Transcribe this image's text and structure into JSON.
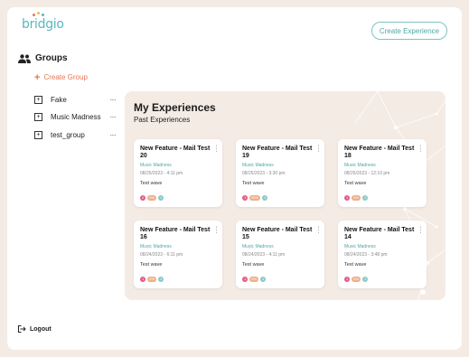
{
  "brand": {
    "logo_text": "bridgio"
  },
  "header": {
    "create_experience_label": "Create Experience"
  },
  "sidebar": {
    "groups_title": "Groups",
    "create_group_label": "Create Group",
    "groups": [
      {
        "label": "Fake",
        "menu": "···"
      },
      {
        "label": "Music Madness",
        "menu": "···"
      },
      {
        "label": "test_group",
        "menu": "···"
      }
    ],
    "logout_label": "Logout"
  },
  "experiences": {
    "title": "My Experiences",
    "subtitle": "Past Experiences",
    "cards": [
      {
        "title": "New Feature - Mail Test 20",
        "group": "Music Madness",
        "date": "08/25/2023 - 4:11 pm",
        "description": "Test wave",
        "badges": [
          "2",
          "0%",
          "1"
        ]
      },
      {
        "title": "New Feature - Mail Test 19",
        "group": "Music Madness",
        "date": "08/25/2023 - 3:30 pm",
        "description": "Test wave",
        "badges": [
          "1",
          "50%",
          "1"
        ]
      },
      {
        "title": "New Feature - Mail Test 18",
        "group": "Music Madness",
        "date": "08/25/2023 - 12:10 pm",
        "description": "Test wave",
        "badges": [
          "1",
          "0%",
          "1"
        ]
      },
      {
        "title": "New Feature - Mail Test 16",
        "group": "Music Madness",
        "date": "08/24/2023 - 6:11 pm",
        "description": "Test wave",
        "badges": [
          "1",
          "0%",
          "1"
        ]
      },
      {
        "title": "New Feature - Mail Test 15",
        "group": "Music Madness",
        "date": "08/24/2023 - 4:11 pm",
        "description": "Test wave",
        "badges": [
          "1",
          "0%",
          "1"
        ]
      },
      {
        "title": "New Feature - Mail Test 14",
        "group": "Music Madness",
        "date": "08/24/2023 - 3:48 pm",
        "description": "Test wave",
        "badges": [
          "1",
          "0%",
          "1"
        ]
      }
    ]
  },
  "colors": {
    "accent_teal": "#58b7bd",
    "accent_orange": "#e87556",
    "panel_bg": "#f4ebe5",
    "badge_pink": "#e75a87",
    "badge_orange": "#eeb089",
    "badge_teal": "#8bc9c8"
  }
}
